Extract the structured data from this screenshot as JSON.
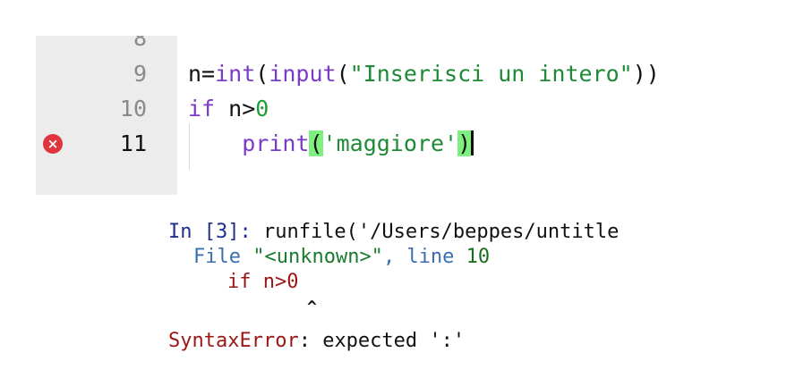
{
  "editor": {
    "lines": [
      {
        "number": "8"
      },
      {
        "number": "9",
        "code": {
          "pre": "n=",
          "int": "int",
          "open": "(",
          "input": "input",
          "paren": "(",
          "string": "\"Inserisci un intero\"",
          "close": "))"
        }
      },
      {
        "number": "10",
        "code": {
          "kw": "if",
          "rest": " n>",
          "num": "0"
        }
      },
      {
        "number": "11",
        "code": {
          "indent": "    ",
          "print": "print",
          "lparen": "(",
          "string": "'maggiore'",
          "rparen": ")"
        }
      }
    ],
    "error_marker_symbol": "×"
  },
  "console": {
    "prompt": "In [3]:",
    "command": " runfile('/Users/beppes/untitle",
    "file_prefix": "File ",
    "file_name": "\"<unknown>\"",
    "file_sep": ", line ",
    "file_line": "10",
    "error_code_kw": "if",
    "error_code_rest": " n>",
    "error_code_num": "0",
    "caret": "^",
    "error_name": "SyntaxError",
    "error_message": ": expected ':'"
  },
  "colors": {
    "keyword": "#7a3cc7",
    "string": "#1f8a36",
    "bracket_match": "#7ff07f",
    "error_marker": "#e0353f",
    "prompt": "#1e2f8f"
  }
}
